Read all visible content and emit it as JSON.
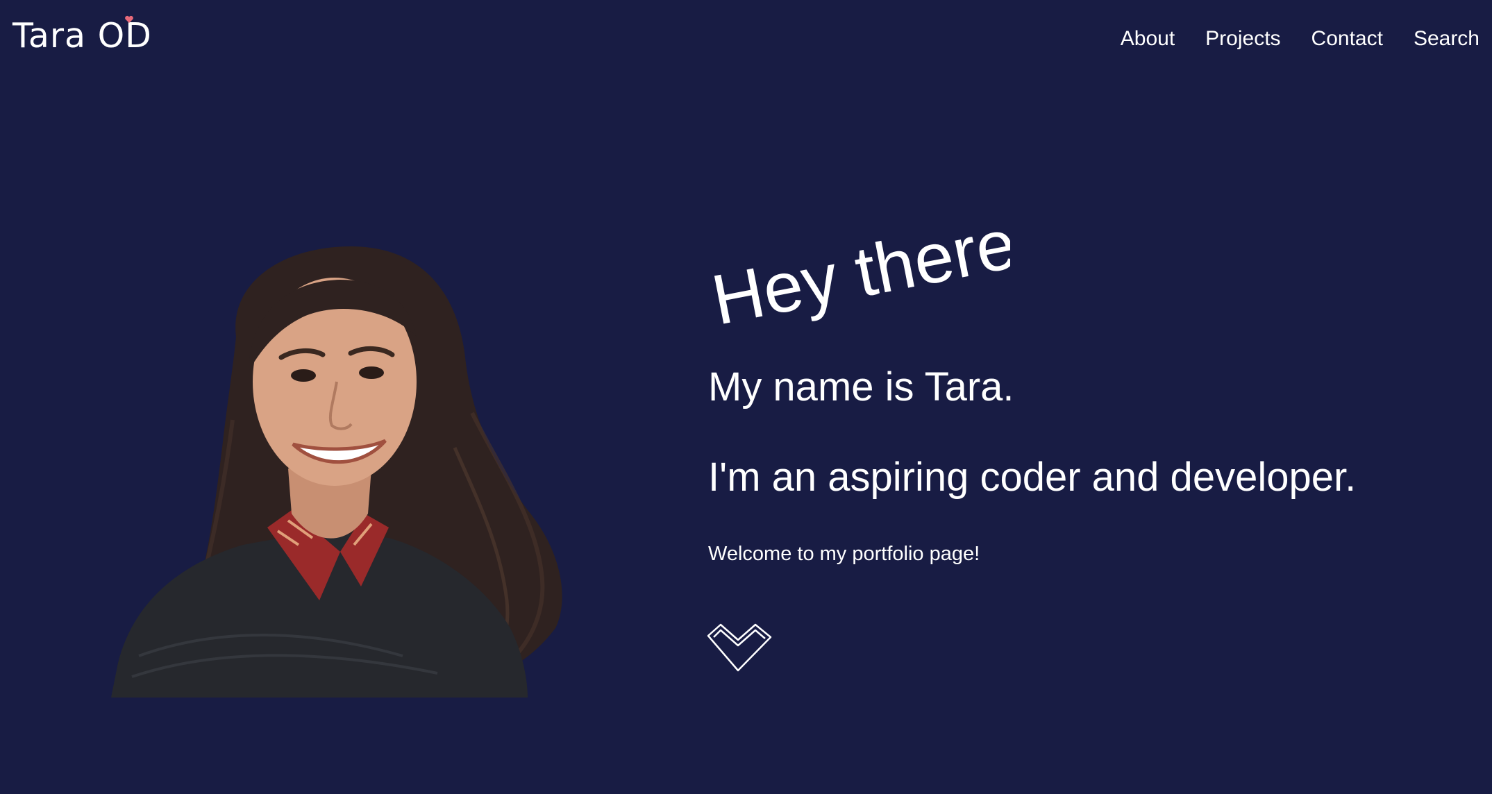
{
  "header": {
    "logo_text": "Tara OD",
    "nav": [
      {
        "label": "About"
      },
      {
        "label": "Projects"
      },
      {
        "label": "Contact"
      },
      {
        "label": "Search"
      }
    ]
  },
  "hero": {
    "greeting": "Hey there!",
    "name_line": "My name is Tara.",
    "tagline": "I'm an aspiring coder and developer.",
    "welcome": "Welcome to my portfolio page!",
    "scroll_icon": "heart-chevron-down-icon",
    "portrait_icon": "profile-photo"
  },
  "colors": {
    "background": "#181c44",
    "text": "#ffffff",
    "logo_accent": "#e86a7a"
  }
}
